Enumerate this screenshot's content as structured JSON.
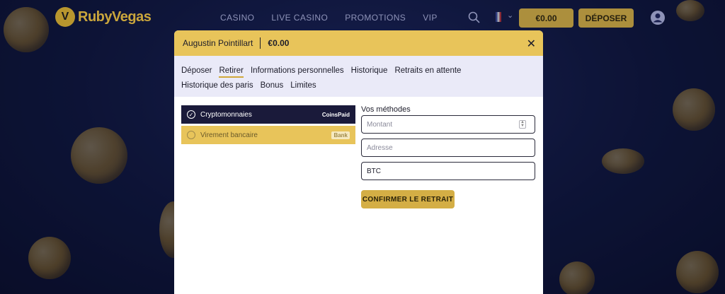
{
  "brand": {
    "logo_letter": "V",
    "name": "RubyVegas"
  },
  "nav": {
    "links": [
      "CASINO",
      "LIVE CASINO",
      "PROMOTIONS",
      "VIP"
    ],
    "balance": "€0.00",
    "deposit_label": "DÉPOSER"
  },
  "modal": {
    "user_name": "Augustin Pointillart",
    "balance": "€0.00",
    "close_glyph": "✕",
    "tabs": [
      "Déposer",
      "Retirer",
      "Informations personnelles",
      "Historique",
      "Retraits en attente",
      "Historique des paris",
      "Bonus",
      "Limites"
    ],
    "active_tab": "Retirer",
    "methods": [
      {
        "label": "Cryptomonnaies",
        "logo": "CoinsPaid",
        "selected": true
      },
      {
        "label": "Virement bancaire",
        "logo": "Bank",
        "selected": false
      }
    ],
    "form": {
      "label": "Vos méthodes",
      "amount_placeholder": "Montant",
      "address_placeholder": "Adresse",
      "currency_value": "BTC",
      "confirm_label": "CONFIRMER LE RETRAIT"
    }
  },
  "colors": {
    "accent": "#e8c45a",
    "dark": "#1a1a3a",
    "background": "#0f1a3f"
  }
}
